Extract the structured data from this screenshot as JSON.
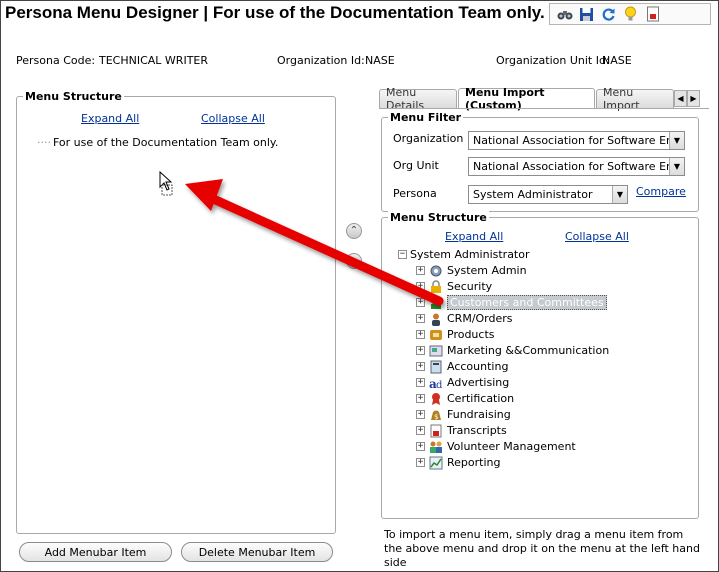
{
  "app": {
    "title": "Persona Menu Designer | For use of the Documentation Team only."
  },
  "toolbar": {
    "icons": [
      "binoculars-icon",
      "save-icon",
      "refresh-icon",
      "lightbulb-icon",
      "report-icon"
    ]
  },
  "info": {
    "persona_code_label": "Persona Code:",
    "persona_code_value": "TECHNICAL WRITER",
    "org_id_label": "Organization Id:",
    "org_id_value": "NASE",
    "org_unit_label": "Organization Unit Id:",
    "org_unit_value": "NASE"
  },
  "left_panel": {
    "legend": "Menu Structure",
    "expand_all": "Expand All",
    "collapse_all": "Collapse All",
    "root_item": "For use of the Documentation Team only."
  },
  "buttons": {
    "add": "Add Menubar Item",
    "delete": "Delete Menubar Item"
  },
  "tabs": [
    {
      "label": "Menu Details"
    },
    {
      "label": "Menu Import (Custom)"
    },
    {
      "label": "Menu Import"
    }
  ],
  "menu_filter": {
    "legend": "Menu Filter",
    "organization_label": "Organization",
    "organization_value": "National Association for Software Engin",
    "org_unit_label": "Org Unit",
    "org_unit_value": "National Association for Software Engin",
    "persona_label": "Persona",
    "persona_value": "System Administrator",
    "compare": "Compare"
  },
  "right_tree": {
    "legend": "Menu Structure",
    "expand_all": "Expand All",
    "collapse_all": "Collapse All",
    "root": "System Administrator",
    "items": [
      "System Admin",
      "Security",
      "Customers and Committees",
      "CRM/Orders",
      "Products",
      "Marketing &&Communication",
      "Accounting",
      "Advertising",
      "Certification",
      "Fundraising",
      "Transcripts",
      "Volunteer Management",
      "Reporting"
    ]
  },
  "hint": "To import a menu item, simply drag a menu item from the above menu and drop it on the menu at the left hand side"
}
